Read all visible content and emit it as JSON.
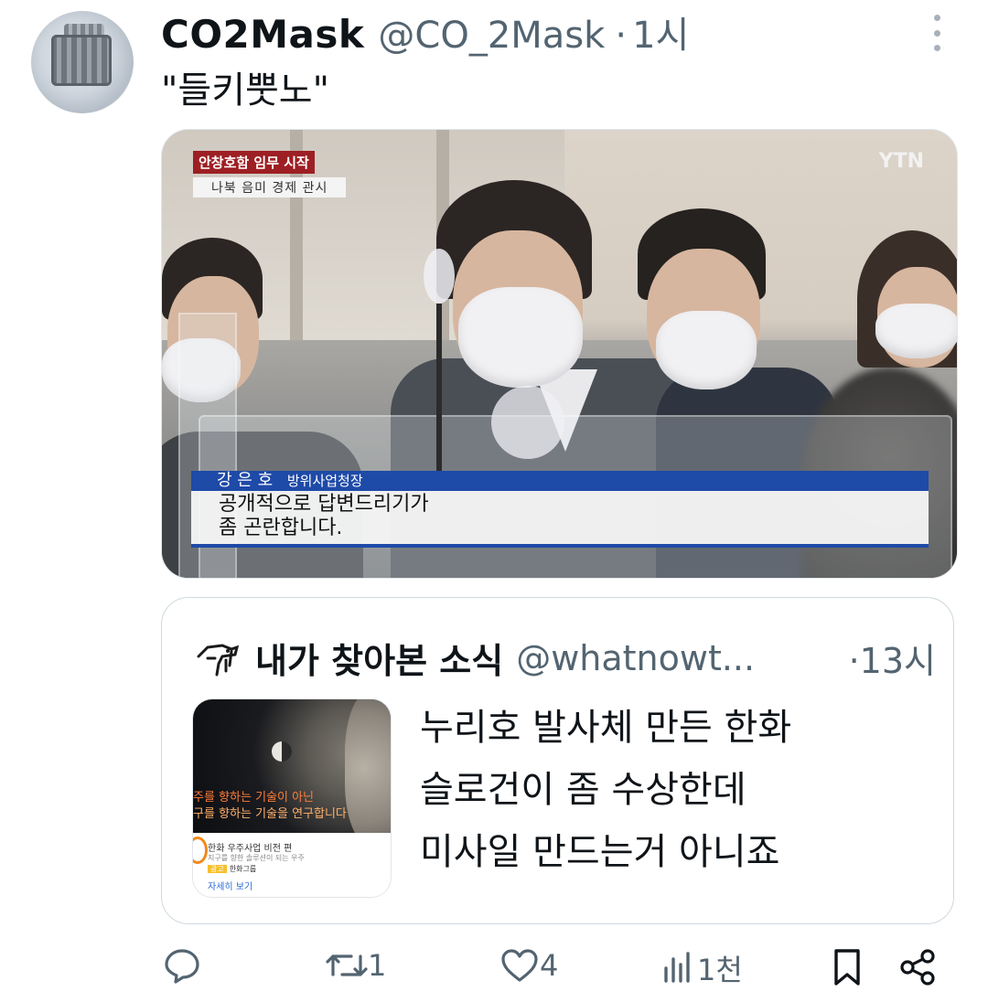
{
  "tweet": {
    "author_name": "CO2Mask",
    "author_handle": "@CO_2Mask",
    "separator": "·",
    "time": "1시",
    "text": "\"들키뿟노\"",
    "avatar_icon": "engine-avatar",
    "more_icon": "more-vertical-icon"
  },
  "media": {
    "top_caption": "안창호함 임무 시작",
    "top_subcaption": "나북 음미 경제 관시",
    "broadcaster": "YTN",
    "speaker_name": "강 은 호",
    "speaker_role": "방위사업청장",
    "subtitle_line1": "공개적으로 답변드리기가",
    "subtitle_line2": "좀 곤란합니다."
  },
  "quote": {
    "author_name": "내가 찾아본 소식",
    "author_handle": "@whatnowt...",
    "separator": "·",
    "time": "13시",
    "text_line1": "누리호 발사체 만든 한화",
    "text_line2": "슬로건이 좀 수상한데",
    "text_line3": "미사일 만드는거 아니죠",
    "thumb_line1": "주를 향하는 기술이 아닌",
    "thumb_line2": "구를 향하는 기술을 연구합니다",
    "ad_title": "한화 우주사업 비전 편",
    "ad_sub": "지구를 향한 솔루션이 되는 우주",
    "ad_badge": "광고",
    "ad_brand": "한화그룹",
    "ad_link": "자세히 보기"
  },
  "actions": {
    "reply_icon": "reply-icon",
    "retweet_icon": "retweet-icon",
    "retweet_count": "1",
    "like_icon": "heart-icon",
    "like_count": "4",
    "views_icon": "views-icon",
    "views_count": "1천",
    "bookmark_icon": "bookmark-icon",
    "share_icon": "share-icon"
  },
  "colors": {
    "text": "#0f1419",
    "secondary": "#536471",
    "border": "#cfd9de",
    "caption_blue": "#1e4aa8",
    "caption_red": "#9d1f23"
  }
}
